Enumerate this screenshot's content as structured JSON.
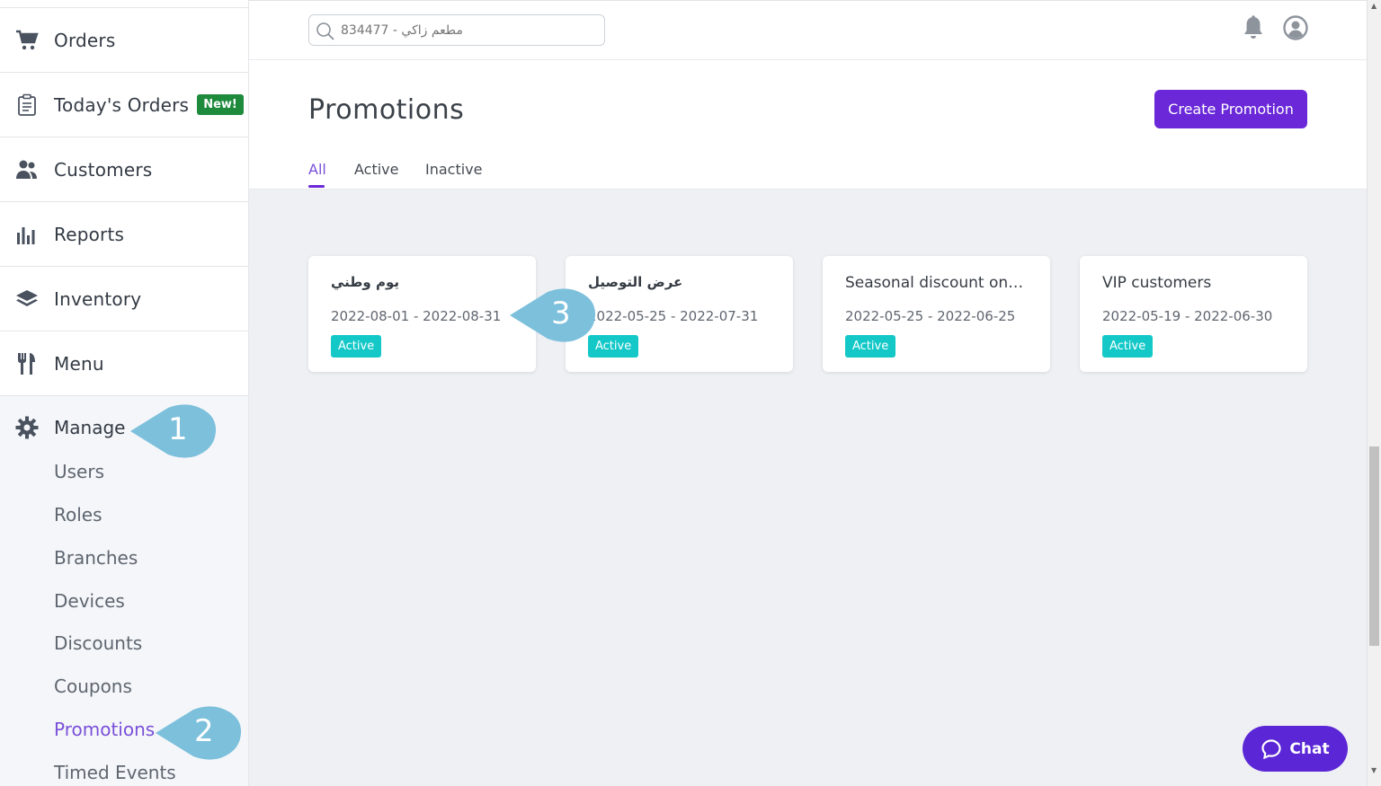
{
  "sidebar": {
    "items": [
      {
        "label": "Orders",
        "icon": "cart-icon"
      },
      {
        "label": "Today's Orders",
        "icon": "clipboard-icon",
        "badge": "New!"
      },
      {
        "label": "Customers",
        "icon": "customers-icon"
      },
      {
        "label": "Reports",
        "icon": "bar-chart-icon"
      },
      {
        "label": "Inventory",
        "icon": "layers-icon"
      },
      {
        "label": "Menu",
        "icon": "utensils-icon"
      }
    ],
    "manage": {
      "label": "Manage",
      "icon": "gear-icon"
    },
    "sub_items": [
      "Users",
      "Roles",
      "Branches",
      "Devices",
      "Discounts",
      "Coupons",
      "Promotions",
      "Timed Events"
    ],
    "active_sub_item": "Promotions"
  },
  "header": {
    "search_placeholder": "مطعم زاكي - 834477",
    "icons": [
      "search-icon",
      "bell-icon",
      "user-avatar-icon"
    ]
  },
  "page": {
    "title": "Promotions",
    "create_button": "Create Promotion",
    "tabs": [
      "All",
      "Active",
      "Inactive"
    ],
    "active_tab": "All"
  },
  "promotions": [
    {
      "name": "يوم وطني",
      "dates": "2022-08-01 - 2022-08-31",
      "status": "Active"
    },
    {
      "name": "عرض التوصيل",
      "dates": "2022-05-25 - 2022-07-31",
      "status": "Active"
    },
    {
      "name": "Seasonal discount on…",
      "dates": "2022-05-25 - 2022-06-25",
      "status": "Active"
    },
    {
      "name": "VIP customers",
      "dates": "2022-05-19 - 2022-06-30",
      "status": "Active"
    }
  ],
  "chat": {
    "label": "Chat",
    "icon": "chat-bubble-icon"
  },
  "callouts": [
    "1",
    "2",
    "3"
  ],
  "colors": {
    "primary": "#6a28d8",
    "active_badge": "#14c8c8",
    "new_badge": "#1d8a3c",
    "callout": "#7cc0dc",
    "active_link": "#7a50d9"
  }
}
